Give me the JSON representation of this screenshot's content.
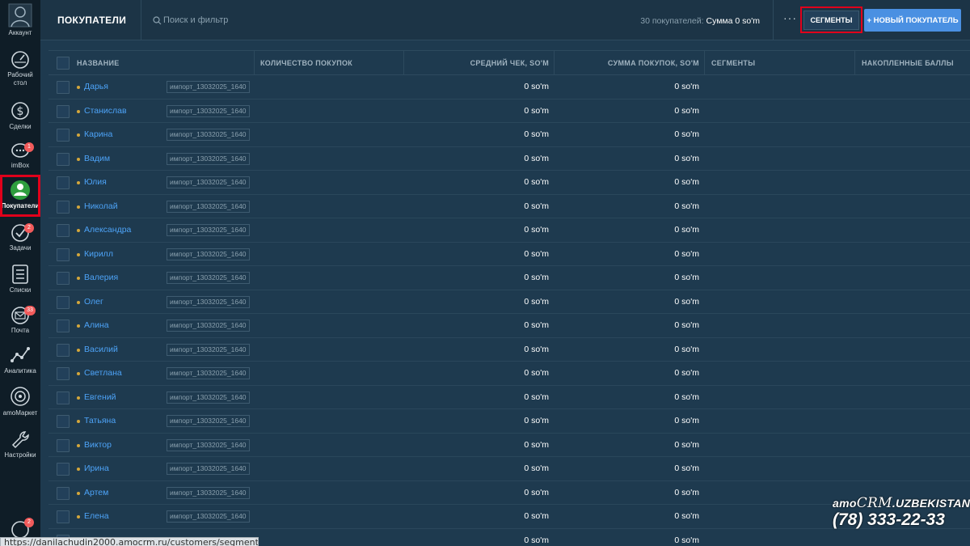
{
  "sidebar": {
    "account": {
      "label": "Аккаунт"
    },
    "items": [
      {
        "label": "Рабочий стол",
        "icon": "dashboard-icon"
      },
      {
        "label": "Сделки",
        "icon": "dollar-icon"
      },
      {
        "label": "imBox",
        "icon": "chat-icon",
        "badge": "1"
      },
      {
        "label": "Покупатели",
        "icon": "customers-icon",
        "active": true
      },
      {
        "label": "Задачи",
        "icon": "checkmark-icon",
        "badge": "2"
      },
      {
        "label": "Списки",
        "icon": "list-icon"
      },
      {
        "label": "Почта",
        "icon": "mail-icon",
        "badge": "33"
      },
      {
        "label": "Аналитика",
        "icon": "analytics-icon"
      },
      {
        "label": "amoМаркет",
        "icon": "market-icon"
      },
      {
        "label": "Настройки",
        "icon": "wrench-icon"
      }
    ],
    "bottom_badge": "2"
  },
  "header": {
    "title": "ПОКУПАТЕЛИ",
    "search_placeholder": "Поиск и фильтр",
    "summary_count": "30 покупателей:",
    "summary_sum": "Сумма 0 so'm",
    "more": "···",
    "segments_button": "СЕГМЕНТЫ",
    "new_button": "+ НОВЫЙ ПОКУПАТЕЛЬ"
  },
  "table": {
    "columns": [
      "НАЗВАНИЕ",
      "КОЛИЧЕСТВО ПОКУПОК",
      "СРЕДНИЙ ЧЕК, SO'M",
      "СУММА ПОКУПОК, SO'M",
      "СЕГМЕНТЫ",
      "НАКОПЛЕННЫЕ БАЛЛЫ"
    ],
    "tag": "импорт_13032025_1640",
    "rows": [
      {
        "name": "Дарья",
        "avg": "0 so'm",
        "sum": "0 so'm"
      },
      {
        "name": "Станислав",
        "avg": "0 so'm",
        "sum": "0 so'm"
      },
      {
        "name": "Карина",
        "avg": "0 so'm",
        "sum": "0 so'm"
      },
      {
        "name": "Вадим",
        "avg": "0 so'm",
        "sum": "0 so'm"
      },
      {
        "name": "Юлия",
        "avg": "0 so'm",
        "sum": "0 so'm"
      },
      {
        "name": "Николай",
        "avg": "0 so'm",
        "sum": "0 so'm"
      },
      {
        "name": "Александра",
        "avg": "0 so'm",
        "sum": "0 so'm"
      },
      {
        "name": "Кирилл",
        "avg": "0 so'm",
        "sum": "0 so'm"
      },
      {
        "name": "Валерия",
        "avg": "0 so'm",
        "sum": "0 so'm"
      },
      {
        "name": "Олег",
        "avg": "0 so'm",
        "sum": "0 so'm"
      },
      {
        "name": "Алина",
        "avg": "0 so'm",
        "sum": "0 so'm"
      },
      {
        "name": "Василий",
        "avg": "0 so'm",
        "sum": "0 so'm"
      },
      {
        "name": "Светлана",
        "avg": "0 so'm",
        "sum": "0 so'm"
      },
      {
        "name": "Евгений",
        "avg": "0 so'm",
        "sum": "0 so'm"
      },
      {
        "name": "Татьяна",
        "avg": "0 so'm",
        "sum": "0 so'm"
      },
      {
        "name": "Виктор",
        "avg": "0 so'm",
        "sum": "0 so'm"
      },
      {
        "name": "Ирина",
        "avg": "0 so'm",
        "sum": "0 so'm"
      },
      {
        "name": "Артем",
        "avg": "0 so'm",
        "sum": "0 so'm"
      },
      {
        "name": "Елена",
        "avg": "0 so'm",
        "sum": "0 so'm"
      },
      {
        "name": "",
        "avg": "0 so'm",
        "sum": "0 so'm"
      }
    ]
  },
  "watermark": {
    "brand_prefix": "amo",
    "brand_crm": "CRM",
    "brand_suffix": ".UZBEKISTAN",
    "phone": "(78) 333-22-33"
  },
  "statusbar": {
    "url": "https://danilachudin2000.amocrm.ru/customers/segments"
  },
  "colors": {
    "sidebar_bg": "#0f1d27",
    "main_bg": "#1e3a4f",
    "link": "#4da3f7",
    "primary_button": "#4a90e2",
    "highlight": "#e0001b"
  }
}
